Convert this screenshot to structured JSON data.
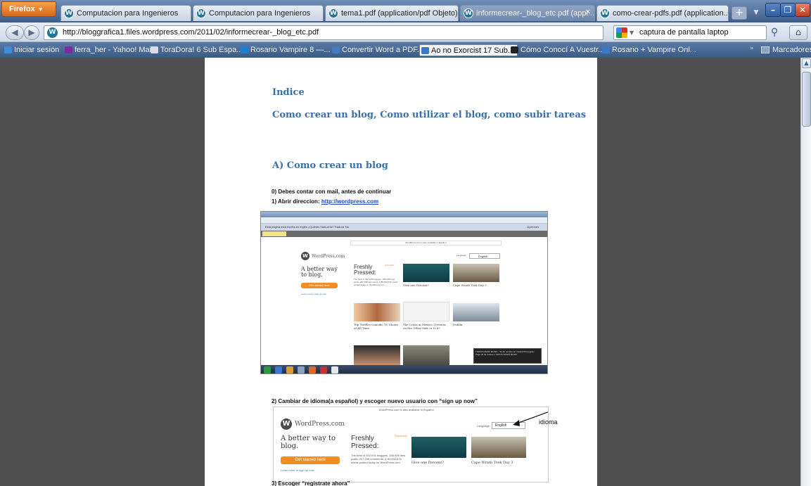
{
  "browser": {
    "menu_label": "Firefox",
    "tabs": [
      {
        "label": "Computacion para Ingenieros",
        "active": false
      },
      {
        "label": "Computacion para Ingenieros",
        "active": false
      },
      {
        "label": "tema1.pdf (application/pdf Objeto)",
        "active": false
      },
      {
        "label": "informecrear-_blog_etc.pdf (appl...",
        "active": true
      },
      {
        "label": "como-crear-pdfs.pdf (application...",
        "active": false
      }
    ],
    "url": "http://bloggrafica1.files.wordpress.com/2011/02/informecrear-_blog_etc.pdf",
    "search_text": "captura de pantalla laptop",
    "bookmarks": [
      {
        "label": "Iniciar sesión",
        "color": "#3f8fd8"
      },
      {
        "label": "ferra_her - Yahoo! Mail",
        "color": "#7b2aa3"
      },
      {
        "label": "ToraDora! 6 Sub Espa...",
        "color": "#d9dde6"
      },
      {
        "label": "Rosario Vampire 8 —...",
        "color": "#1b7fd6"
      },
      {
        "label": "Convertir Word a PDF...",
        "color": "#4a78c2"
      },
      {
        "label": "Ao no Exorcist 17 Sub...",
        "color": "#3a78c8"
      },
      {
        "label": "Cómo Conocí A Vuestr...",
        "color": "#222222"
      },
      {
        "label": "Rosario + Vampire Onl...",
        "color": "#3a78c8"
      }
    ],
    "bookmarks_folder": "Marcadores"
  },
  "document": {
    "index_title": "Indice",
    "subtitle": "Como crear un blog, Como utilizar el blog, como subir tareas",
    "section_a": "A) Como crear un blog",
    "step0": "0)   Debes contar con mail, antes de continuar",
    "step1_prefix": "1)   Abrir direccion: ",
    "step1_link": "http://wordpress.com",
    "step2": "2)   Cambiar de idioma(a español)  y escoger nuevo usuario con “sign up now”",
    "step3": "3)   Escoger  “registrate ahora”",
    "annotation": "idioma"
  },
  "screenshot1": {
    "translate_bar": "Esta página está escrita en  inglés  ¿Quieres traducirla?   Traducir   No",
    "translate_options": "Opciones",
    "notice": "WordPress.com is also available in Español",
    "logo": "WordPress.com",
    "lang_label": "Language:",
    "lang_value": "English",
    "tagline": "A better way to blog.",
    "cta": "Get started here",
    "learn_more": "Learn more or sign up now",
    "fresh_title": "Freshly Pressed:",
    "fresh_stats": "The best of 392,978 bloggers, 356,908 new posts, 297,298 comments, & 83,832,676 words posted today on WordPress.com",
    "subscribe": "Subscribe",
    "captions": [
      "Give one Percent?",
      "Cape Wrath Trek Day 3",
      "Top Twelve Comedic TV Shows of All Time",
      "The Crisis in Mexico: Greener on the Other Side or Is it?",
      "Dublin"
    ],
    "tooltip": "TODOS RADIO MUSIC - Su de nombre en musica Phonogram Page 32 de Carlos a TODOS RADIO MUSIC"
  },
  "screenshot2": {
    "notice": "WordPress.com is also available in Español",
    "logo": "WordPress.com",
    "lang_label": "Language:",
    "lang_value": "English",
    "tagline": "A better way to blog.",
    "cta": "Get started here",
    "learn_more": "Learn more or sign up now",
    "fresh_title": "Freshly Pressed:",
    "fresh_stats": "The best of 392,978 bloggers, 356,908 new posts, 297,298 comments, & 83,832,676 words posted today on WordPress.com",
    "subscribe": "Subscribe",
    "captions": [
      "Give one Percent?",
      "Cape Wrath Trek Day 3"
    ]
  },
  "colors": {
    "heading_blue": "#3b6fa7",
    "link_blue": "#1a47c9",
    "cta_orange": "#f08d24"
  }
}
